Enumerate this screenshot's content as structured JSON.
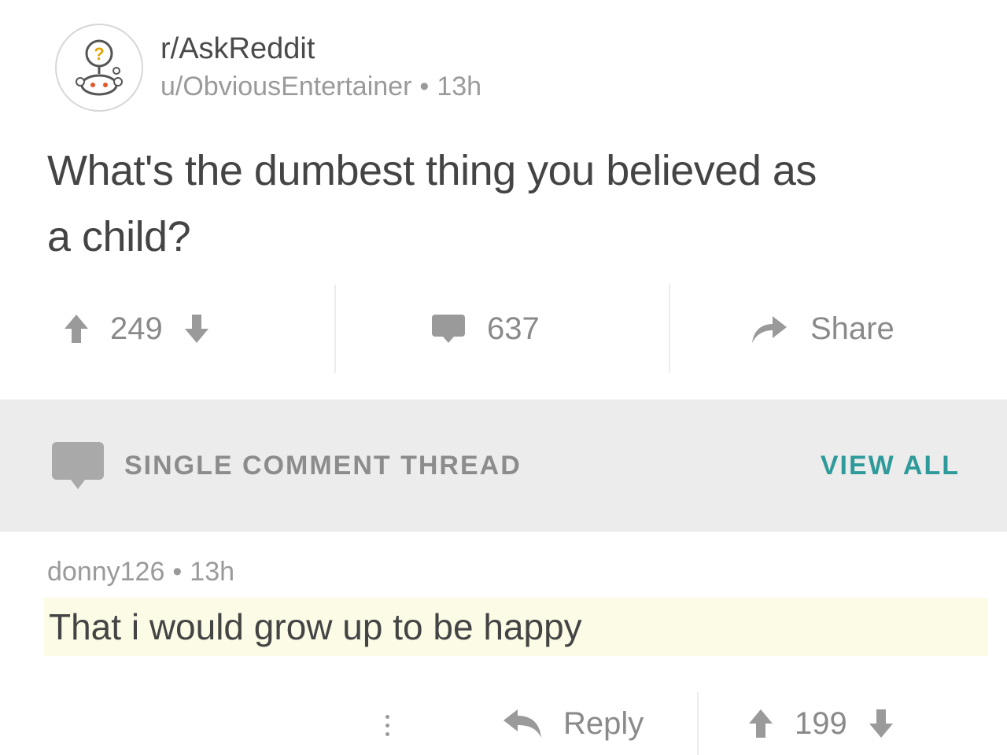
{
  "post": {
    "subreddit": "r/AskReddit",
    "author": "u/ObviousEntertainer",
    "separator": "•",
    "age": "13h",
    "title": "What's the dumbest thing you believed as a child?",
    "upvotes": "249",
    "comments": "637",
    "share_label": "Share"
  },
  "thread_banner": {
    "label": "SINGLE COMMENT THREAD",
    "view_all": "VIEW ALL"
  },
  "comment": {
    "author": "donny126",
    "separator": "•",
    "age": "13h",
    "body": "That i would grow up to be happy",
    "reply_label": "Reply",
    "votes": "199"
  },
  "icons": {
    "subreddit_avatar": "askreddit-snoo-icon",
    "upvote": "upvote-arrow-icon",
    "downvote": "downvote-arrow-icon",
    "comment": "comment-bubble-icon",
    "share": "share-arrow-icon",
    "reply": "reply-arrow-icon",
    "more": "more-dots-icon"
  },
  "colors": {
    "accent_teal": "#2e9a9a",
    "banner_bg": "#ececec",
    "highlight_bg": "#fbfbe6",
    "icon_gray": "#9a9a9a"
  }
}
